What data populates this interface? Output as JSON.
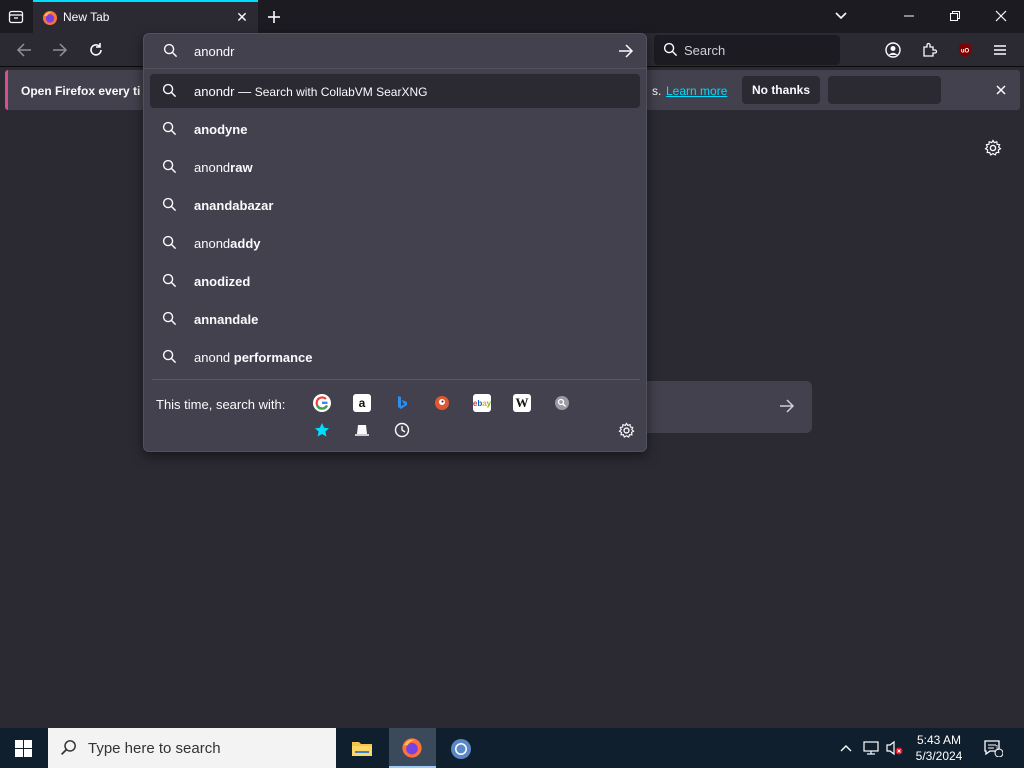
{
  "tab": {
    "title": "New Tab",
    "close": "✕"
  },
  "navbar": {
    "search_placeholder": "Search"
  },
  "notification": {
    "message": "Open Firefox every ti",
    "tail": "s.",
    "learn_more": "Learn more",
    "no_thanks": "No thanks"
  },
  "urlbar": {
    "input": "anondr",
    "first_suggestion": {
      "typed": "anondr",
      "dash": " — ",
      "action": "Search with CollabVM SearXNG"
    },
    "suggestions": [
      {
        "prefix": "",
        "bold": "anodyne"
      },
      {
        "prefix": "anond",
        "bold": "raw"
      },
      {
        "prefix": "",
        "bold": "anandabazar"
      },
      {
        "prefix": "anond",
        "bold": "addy"
      },
      {
        "prefix": "",
        "bold": "anodized"
      },
      {
        "prefix": "",
        "bold": "annandale"
      },
      {
        "prefix": "anond ",
        "bold": "performance"
      }
    ],
    "footer_label": "This time, search with:",
    "engines": [
      "google-icon",
      "amazon-icon",
      "bing-icon",
      "duckduckgo-icon",
      "ebay-icon",
      "wikipedia-icon",
      "searxng-icon",
      "bookmarks-icon",
      "tabs-icon",
      "history-icon"
    ]
  },
  "taskbar": {
    "search_placeholder": "Type here to search",
    "time": "5:43 AM",
    "date": "5/3/2024",
    "notif_count": "1"
  },
  "colors": {
    "accent": "#00ddff",
    "notif_border": "#d84e8e"
  }
}
